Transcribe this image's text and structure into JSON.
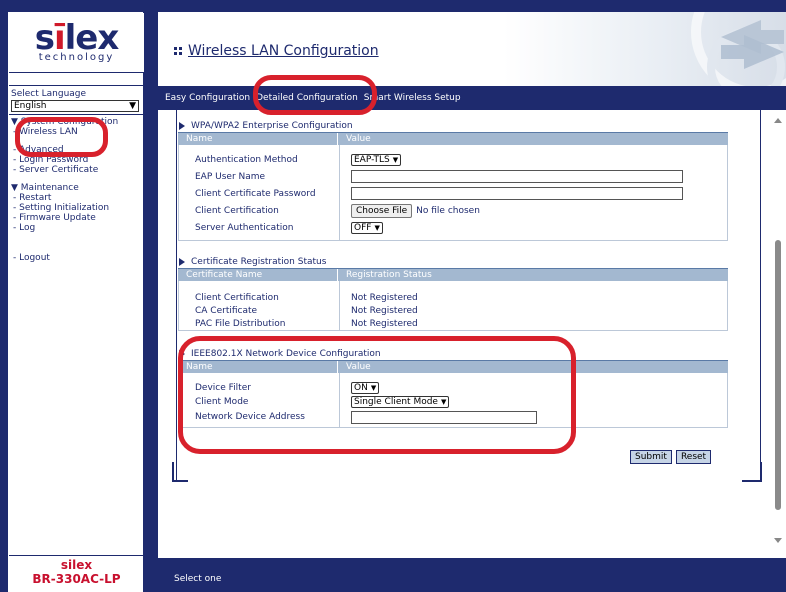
{
  "sidebar": {
    "logo_main": "silex",
    "logo_sub": "technology",
    "language_label": "Select Language",
    "language_value": "English",
    "nav": [
      {
        "label": "▼ System Configuration",
        "type": "head"
      },
      {
        "label": "- Wireless LAN",
        "type": "item"
      },
      {
        "label": "- Advanced",
        "type": "item"
      },
      {
        "label": "- Login Password",
        "type": "item"
      },
      {
        "label": "- Server Certificate",
        "type": "item"
      },
      {
        "label": "▼ Maintenance",
        "type": "head"
      },
      {
        "label": "- Restart",
        "type": "item"
      },
      {
        "label": "- Setting Initialization",
        "type": "item"
      },
      {
        "label": "- Firmware Update",
        "type": "item"
      },
      {
        "label": "- Log",
        "type": "item"
      },
      {
        "label": "- Logout",
        "type": "item"
      }
    ],
    "model_vendor": "silex",
    "model_name": "BR-330AC-LP"
  },
  "header": {
    "title": "Wireless LAN Configuration"
  },
  "tabs": [
    {
      "label": "Easy Configuration"
    },
    {
      "label": "Detailed Configuration"
    },
    {
      "label": "Smart Wireless Setup"
    }
  ],
  "enterprise": {
    "title": "WPA/WPA2 Enterprise Configuration",
    "col_name": "Name",
    "col_value": "Value",
    "auth_method_label": "Authentication Method",
    "auth_method_value": "EAP-TLS",
    "eap_user_label": "EAP User Name",
    "client_cert_pw_label": "Client Certificate Password",
    "client_cert_label": "Client Certification",
    "choose_file_label": "Choose File",
    "no_file_label": "No file chosen",
    "server_auth_label": "Server Authentication",
    "server_auth_value": "OFF"
  },
  "cert_status": {
    "title": "Certificate Registration Status",
    "col_name": "Certificate Name",
    "col_value": "Registration Status",
    "rows": [
      {
        "name": "Client Certification",
        "status": "Not Registered"
      },
      {
        "name": "CA Certificate",
        "status": "Not Registered"
      },
      {
        "name": "PAC File Distribution",
        "status": "Not Registered"
      }
    ]
  },
  "device": {
    "title": "IEEE802.1X Network Device Configuration",
    "col_name": "Name",
    "col_value": "Value",
    "filter_label": "Device Filter",
    "filter_value": "ON",
    "client_mode_label": "Client Mode",
    "client_mode_value": "Single Client Mode",
    "address_label": "Network Device Address"
  },
  "buttons": {
    "submit": "Submit",
    "reset": "Reset"
  },
  "status_bar": "Select one",
  "colors": {
    "frame": "#1e2a6e",
    "highlight": "#d8212c",
    "table_header": "#a3b8d0"
  }
}
